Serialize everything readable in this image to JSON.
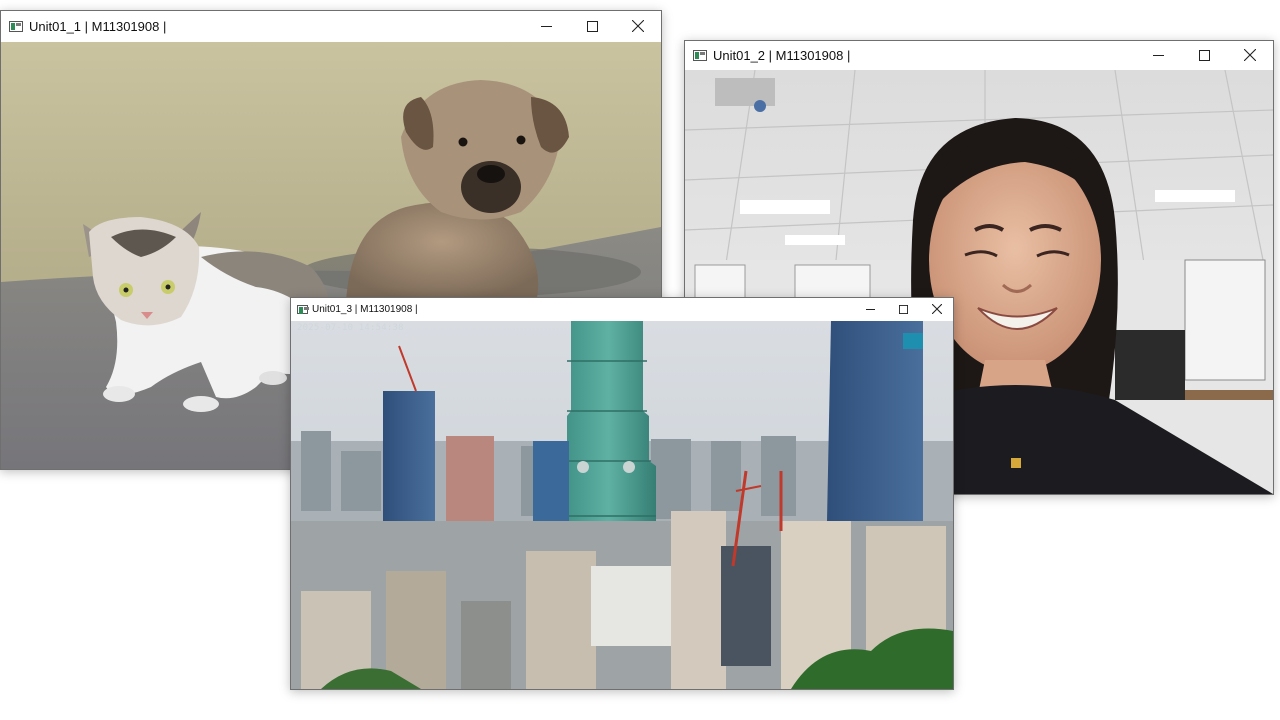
{
  "windows": [
    {
      "title": "Unit01_1 | M11301908 |",
      "image": "cat and puppy photo"
    },
    {
      "title": "Unit01_2 | M11301908 |",
      "image": "webcam capture of smiling woman in office"
    },
    {
      "title": "Unit01_3 | M11301908 |",
      "image": "Taipei city skyline with Taipei 101",
      "timestamp": "2025-07-10 14:54:38"
    }
  ],
  "controls": {
    "minimize": "minimize-icon",
    "maximize": "maximize-icon",
    "close": "close-icon"
  }
}
